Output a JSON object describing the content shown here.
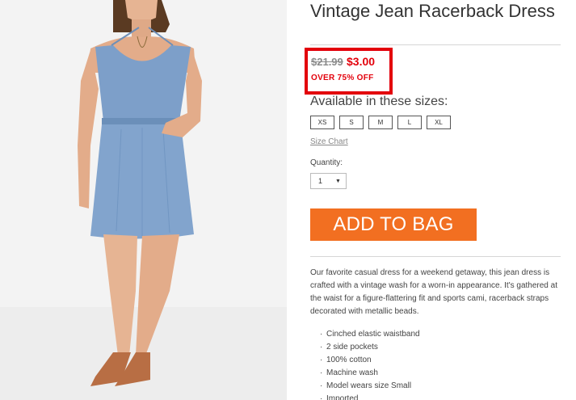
{
  "product": {
    "title": "Vintage Jean Racerback Dress",
    "price_was": "$21.99",
    "price_now": "$3.00",
    "discount": "OVER 75% OFF",
    "sizes_heading": "Available in these sizes:",
    "sizes": [
      "XS",
      "S",
      "M",
      "L",
      "XL"
    ],
    "size_chart": "Size Chart",
    "quantity_label": "Quantity:",
    "quantity_value": "1",
    "add_to_bag": "ADD TO BAG",
    "description": "Our favorite casual dress for a weekend getaway, this jean dress is crafted with a vintage wash for a worn-in appearance. It's gathered at the waist for a figure-flattering fit and sports cami, racerback straps decorated with metallic beads.",
    "features": [
      "Cinched elastic waistband",
      "2 side pockets",
      "100% cotton",
      "Machine wash",
      "Model wears size Small",
      "Imported"
    ]
  },
  "colors": {
    "accent_red": "#e3000b",
    "button_orange": "#f26f21",
    "dress_blue": "#7d9fc9"
  },
  "icons": {
    "quantity_dropdown": "chevron-down-icon"
  }
}
